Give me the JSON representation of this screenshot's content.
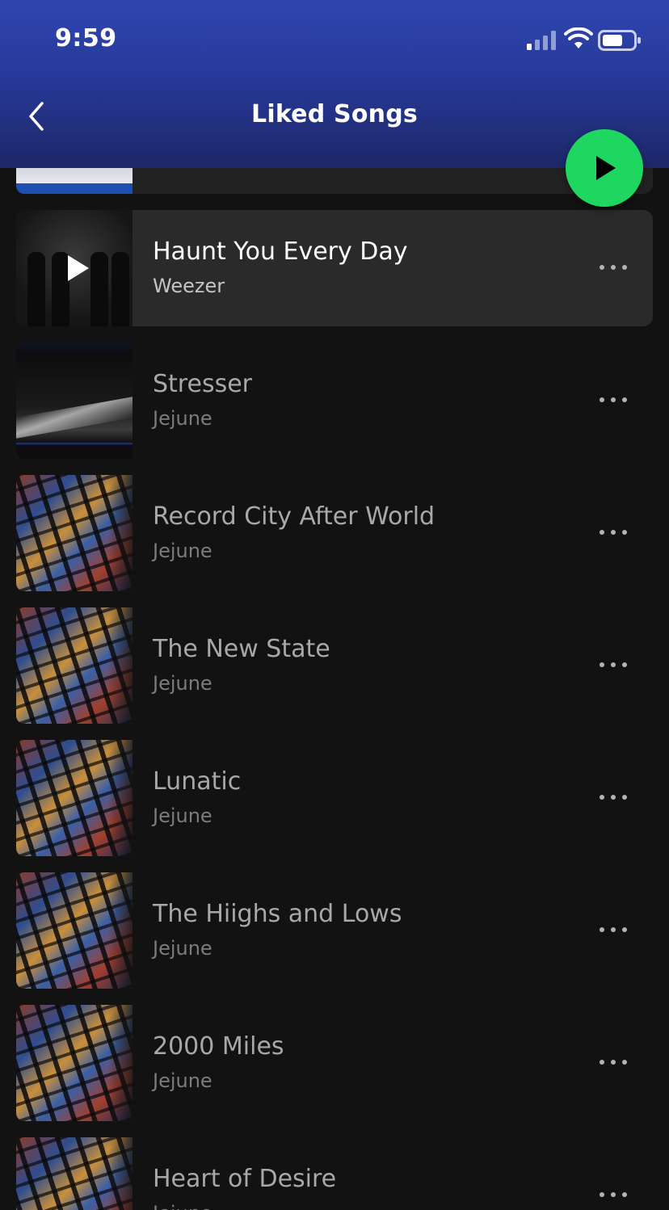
{
  "status_bar": {
    "time": "9:59"
  },
  "header": {
    "title": "Liked Songs"
  },
  "colors": {
    "accent": "#1ed760",
    "header_gradient_top": "#3046b0",
    "background": "#121212"
  },
  "tracks": [
    {
      "title": "Haunt You Every Day",
      "artist": "Weezer",
      "active": true
    },
    {
      "title": "Stresser",
      "artist": "Jejune"
    },
    {
      "title": "Record City After World",
      "artist": "Jejune"
    },
    {
      "title": "The New State",
      "artist": "Jejune"
    },
    {
      "title": "Lunatic",
      "artist": "Jejune"
    },
    {
      "title": "The Hiighs and Lows",
      "artist": "Jejune"
    },
    {
      "title": "2000 Miles",
      "artist": "Jejune"
    },
    {
      "title": "Heart of Desire",
      "artist": "Jejune"
    }
  ],
  "icons": {
    "back": "chevron-left-icon",
    "play": "play-icon",
    "more": "more-horizontal-icon",
    "signal": "cellular-signal-icon",
    "wifi": "wifi-icon",
    "battery": "battery-icon"
  }
}
